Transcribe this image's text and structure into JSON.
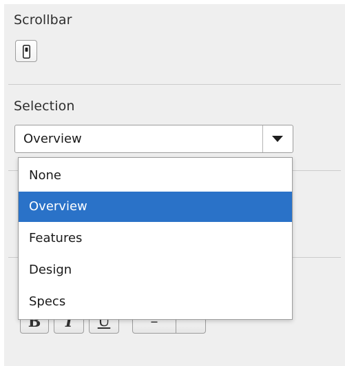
{
  "scrollbar": {
    "title": "Scrollbar",
    "toggle_icon": "scrollbar-icon"
  },
  "selection": {
    "title": "Selection",
    "value": "Overview",
    "arrow_icon": "triangle-down-icon",
    "options": [
      {
        "label": "None",
        "selected": false
      },
      {
        "label": "Overview",
        "selected": true
      },
      {
        "label": "Features",
        "selected": false
      },
      {
        "label": "Design",
        "selected": false
      },
      {
        "label": "Specs",
        "selected": false
      }
    ]
  },
  "formatting_toolbar": {
    "buttons": [
      {
        "icon": "bold-icon",
        "glyph": "B"
      },
      {
        "icon": "italic-icon",
        "glyph": "I"
      },
      {
        "icon": "underline-icon",
        "glyph": "U"
      },
      {
        "icon": "list-icon",
        "glyph": "–"
      },
      {
        "icon": "more-icon",
        "glyph": ""
      }
    ]
  },
  "colors": {
    "panel_bg": "#efefef",
    "selected_bg": "#2a72c8",
    "divider": "#cccccc"
  }
}
